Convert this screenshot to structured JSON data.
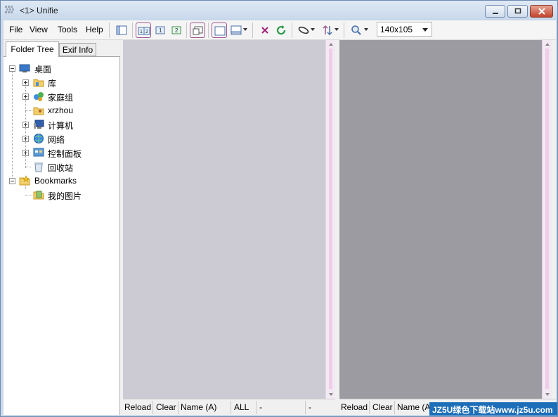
{
  "window": {
    "title": "<1> Unifie",
    "colors": {
      "frame": "#cbd9ea",
      "close_button": "#c2442d"
    }
  },
  "menu": {
    "items": [
      "File",
      "View",
      "Tools",
      "Help"
    ]
  },
  "toolbar": {
    "thumbnail_size": "140x105",
    "icons": [
      "panel-toggle-icon",
      "dual-view-icon",
      "view-1-icon",
      "view-2-icon",
      "window-icon",
      "frame-icon",
      "layout-icon",
      "delete-icon",
      "refresh-icon",
      "link-icon",
      "sort-icon",
      "zoom-icon"
    ]
  },
  "left_panel": {
    "tabs": [
      "Folder Tree",
      "Exif Info"
    ],
    "tree": [
      {
        "label": "桌面",
        "icon": "desktop-icon"
      },
      {
        "label": "库",
        "icon": "library-icon"
      },
      {
        "label": "家庭组",
        "icon": "homegroup-icon"
      },
      {
        "label": "xrzhou",
        "icon": "user-folder-icon"
      },
      {
        "label": "计算机",
        "icon": "computer-icon"
      },
      {
        "label": "网络",
        "icon": "network-icon"
      },
      {
        "label": "控制面板",
        "icon": "control-panel-icon"
      },
      {
        "label": "回收站",
        "icon": "recycle-bin-icon"
      },
      {
        "label": "Bookmarks",
        "icon": "bookmarks-icon"
      },
      {
        "label": "我的图片",
        "icon": "pictures-folder-icon"
      }
    ]
  },
  "panes": {
    "left": {
      "status": {
        "reload": "Reload",
        "clear": "Clear",
        "sort": "Name (A)",
        "filter": "ALL",
        "info1": "-",
        "info2": "-"
      }
    },
    "right": {
      "status": {
        "reload": "Reload",
        "clear": "Clear",
        "sort": "Name (A)"
      }
    },
    "colors": {
      "left_bg": "#cccbd4",
      "right_bg": "#9c9ba2"
    }
  },
  "watermark": "JZ5U绿色下载站www.jz5u.com"
}
